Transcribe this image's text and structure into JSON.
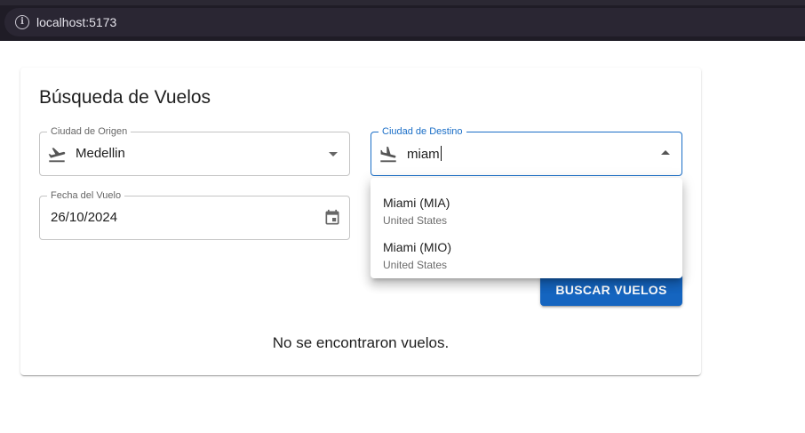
{
  "browser": {
    "url": "localhost:5173"
  },
  "form": {
    "title": "Búsqueda de Vuelos",
    "origin": {
      "label": "Ciudad de Origen",
      "value": "Medellin",
      "icon": "flight-takeoff-icon"
    },
    "destination": {
      "label": "Ciudad de Destino",
      "value": "miam",
      "icon": "flight-land-icon"
    },
    "date": {
      "label": "Fecha del Vuelo",
      "value": "26/10/2024",
      "icon": "calendar-icon"
    },
    "search_button": "BUSCAR VUELOS",
    "no_results": "No se encontraron vuelos."
  },
  "suggestions": [
    {
      "name": "Miami (MIA)",
      "country": "United States"
    },
    {
      "name": "Miami (MIO)",
      "country": "United States"
    }
  ],
  "colors": {
    "accent": "#1565c0",
    "browser_bar": "#1f1c26"
  }
}
